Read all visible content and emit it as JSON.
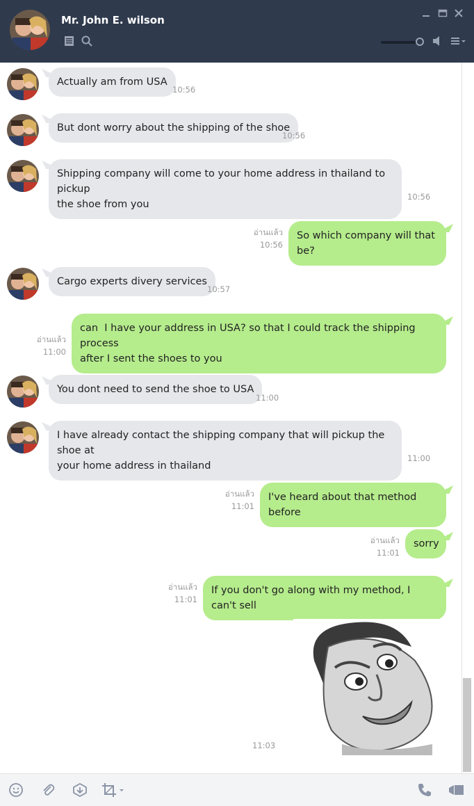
{
  "contact": {
    "name": "Mr. John E. wilson"
  },
  "messages": [
    {
      "text": "Actually am from USA",
      "time": "10:56"
    },
    {
      "text": "But dont worry about the shipping of the shoe",
      "time": "10:56"
    },
    {
      "text": "Shipping company will come to your home address in thailand to pickup\nthe shoe from you",
      "time": "10:56"
    },
    {
      "text": "So which company will that be?",
      "time": "10:56",
      "read": "อ่านแล้ว"
    },
    {
      "text": "Cargo experts divery services",
      "time": "10:57"
    },
    {
      "text": "can  I have your address in USA? so that I could track the shipping process\nafter I sent the shoes to you",
      "time": "11:00",
      "read": "อ่านแล้ว"
    },
    {
      "text": "You dont need to send the shoe to USA",
      "time": "11:00"
    },
    {
      "text": "I have already contact the shipping company that will pickup the shoe at\nyour home address in thailand",
      "time": "11:00"
    },
    {
      "text": "I've heard about that method before",
      "time": "11:01",
      "read": "อ่านแล้ว"
    },
    {
      "text": "sorry",
      "time": "11:01",
      "read": "อ่านแล้ว"
    },
    {
      "text": "If you don't go along with my method, I can't sell",
      "time": "11:01",
      "read": "อ่านแล้ว"
    },
    {
      "sticker": "face-sticker",
      "time": "11:03"
    }
  ]
}
